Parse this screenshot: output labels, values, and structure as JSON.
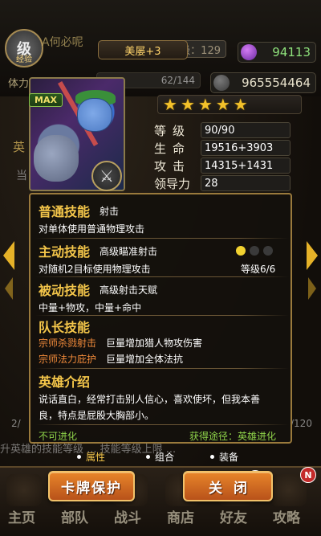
{
  "background": {
    "player_name": "A何必呢",
    "avatar_label": "级",
    "avatar_sub": "经验",
    "level_text": "级：129",
    "stamina_label": "体力",
    "stamina_value": "62/144",
    "gems": "94113",
    "gold": "965554464",
    "left_text_1": "英",
    "left_text_2": "当",
    "page_left": "2/",
    "page_right": "/120",
    "hint": "升英雄的技能等级 ... 技能等级上限 ..."
  },
  "hero": {
    "beauty_badge": "美屡+3",
    "max_badge": "MAX",
    "stars": [
      "★",
      "★",
      "★",
      "★",
      "★"
    ],
    "stats": [
      {
        "label": "等级",
        "value": "90/90"
      },
      {
        "label": "生命",
        "value": "19516+3903"
      },
      {
        "label": "攻击",
        "value": "14315+1431"
      },
      {
        "label": "领导力",
        "value": "28"
      }
    ]
  },
  "panel": {
    "normal_skill_title": "普通技能",
    "normal_skill_name": "射击",
    "normal_skill_desc": "对单体使用普通物理攻击",
    "active_skill_title": "主动技能",
    "active_skill_name": "高级瞄准射击",
    "active_skill_desc": "对随机2目标使用物理攻击",
    "active_skill_level": "等级6/6",
    "passive_skill_title": "被动技能",
    "passive_skill_name": "高级射击天赋",
    "passive_skill_desc": "中量+物攻，中量+命中",
    "leader_title": "队长技能",
    "leader_skills": [
      {
        "name": "宗师杀戮射击",
        "desc": "巨量增加猎人物攻伤害"
      },
      {
        "name": "宗师法力庇护",
        "desc": "巨量增加全体法抗"
      }
    ],
    "intro_title": "英雄介绍",
    "intro_text_1": "说话直白，经常打击别人信心，喜欢使坏，但我本善",
    "intro_text_2": "良，特点是屁股大胸部小。",
    "evolve_text": "不可进化",
    "source_text": "获得途径：英雄进化",
    "dot_colors": [
      "#f2d230",
      "#3a3a3a",
      "#3a3a3a"
    ]
  },
  "tabs": [
    {
      "label": "属性",
      "active": true
    },
    {
      "label": "组合",
      "active": false
    },
    {
      "label": "装备",
      "active": false
    }
  ],
  "buttons": {
    "card_protect": "卡牌保护",
    "close": "关闭"
  },
  "bottom_nav": [
    "主页",
    "部队",
    "战斗",
    "商店",
    "好友",
    "攻略"
  ],
  "new_badge": "N"
}
